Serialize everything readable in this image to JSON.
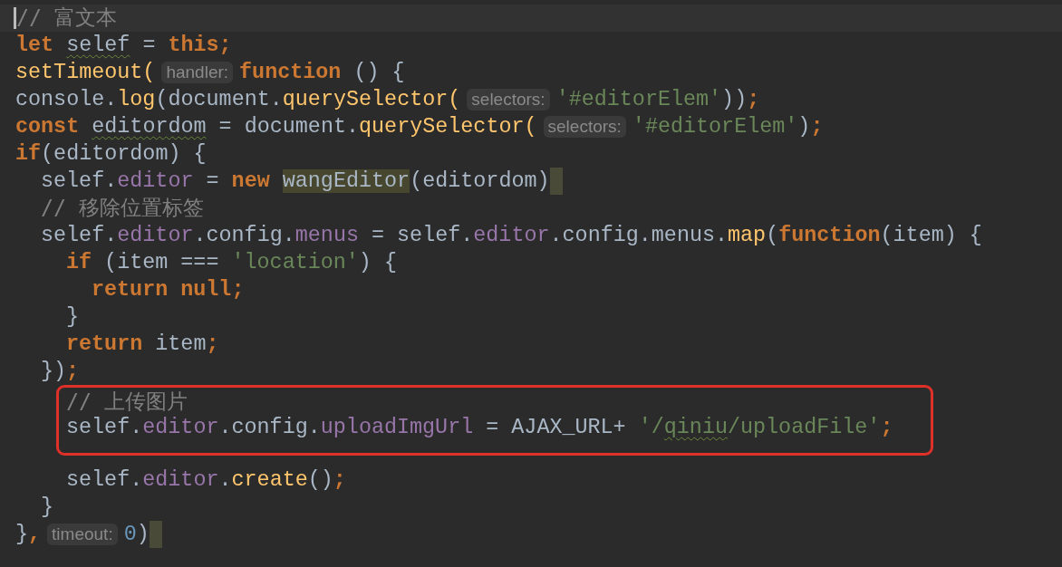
{
  "editor": {
    "lines": [
      {
        "current": true,
        "cursor": true,
        "tokens": [
          {
            "kind": "comment",
            "text": "// 富文本"
          }
        ]
      },
      {
        "tokens": [
          {
            "kind": "keyword",
            "text": "let "
          },
          {
            "kind": "text",
            "text": "selef",
            "warning": true
          },
          {
            "kind": "text",
            "text": " = "
          },
          {
            "kind": "keyword",
            "text": "this;"
          }
        ]
      },
      {
        "tokens": [
          {
            "kind": "call",
            "text": "setTimeout("
          },
          {
            "kind": "hint",
            "text": "handler:"
          },
          {
            "kind": "keyword",
            "text": "function"
          },
          {
            "kind": "text",
            "text": " () {"
          }
        ]
      },
      {
        "tokens": [
          {
            "kind": "text",
            "text": "console."
          },
          {
            "kind": "call",
            "text": "log"
          },
          {
            "kind": "text",
            "text": "(document."
          },
          {
            "kind": "call",
            "text": "querySelector("
          },
          {
            "kind": "hint",
            "text": "selectors:"
          },
          {
            "kind": "string",
            "text": "'#editorElem'"
          },
          {
            "kind": "text",
            "text": "))"
          },
          {
            "kind": "keyword",
            "text": ";"
          }
        ]
      },
      {
        "tokens": [
          {
            "kind": "keyword",
            "text": "const "
          },
          {
            "kind": "text",
            "text": "editordom",
            "warning": true
          },
          {
            "kind": "text",
            "text": " = document."
          },
          {
            "kind": "call",
            "text": "querySelector("
          },
          {
            "kind": "hint",
            "text": "selectors:"
          },
          {
            "kind": "string",
            "text": "'#editorElem'"
          },
          {
            "kind": "text",
            "text": ")"
          },
          {
            "kind": "keyword",
            "text": ";"
          }
        ]
      },
      {
        "tokens": [
          {
            "kind": "keyword",
            "text": "if"
          },
          {
            "kind": "text",
            "text": "(editordom) {"
          }
        ],
        "children": [
          {
            "bracket_marker": true,
            "tokens": [
              {
                "kind": "text",
                "text": "selef."
              },
              {
                "kind": "field",
                "text": "editor"
              },
              {
                "kind": "text",
                "text": " = "
              },
              {
                "kind": "keyword",
                "text": "new "
              },
              {
                "kind": "text",
                "text": "wangEditor",
                "highlighted": true
              },
              {
                "kind": "text",
                "text": "(editordom)"
              }
            ]
          },
          {
            "tokens": [
              {
                "kind": "comment",
                "text": "// 移除位置标签"
              }
            ]
          },
          {
            "tokens": [
              {
                "kind": "text",
                "text": "selef."
              },
              {
                "kind": "field",
                "text": "editor"
              },
              {
                "kind": "text",
                "text": ".config."
              },
              {
                "kind": "field",
                "text": "menus"
              },
              {
                "kind": "text",
                "text": " = selef."
              },
              {
                "kind": "field",
                "text": "editor"
              },
              {
                "kind": "text",
                "text": ".config.menus."
              },
              {
                "kind": "call",
                "text": "map"
              },
              {
                "kind": "text",
                "text": "("
              },
              {
                "kind": "keyword",
                "text": "function"
              },
              {
                "kind": "text",
                "text": "(item) {"
              }
            ],
            "children": [
              {
                "tokens": [
                  {
                    "kind": "keyword",
                    "text": "if"
                  },
                  {
                    "kind": "text",
                    "text": " (item === "
                  },
                  {
                    "kind": "string",
                    "text": "'location'"
                  },
                  {
                    "kind": "text",
                    "text": ") {"
                  }
                ],
                "children": [
                  {
                    "tokens": [
                      {
                        "kind": "keyword",
                        "text": "return null;"
                      }
                    ]
                  }
                ]
              },
              {
                "tokens": [
                  {
                    "kind": "text",
                    "text": "}"
                  }
                ]
              },
              {
                "tokens": [
                  {
                    "kind": "keyword",
                    "text": "return"
                  },
                  {
                    "kind": "text",
                    "text": " item"
                  },
                  {
                    "kind": "keyword",
                    "text": ";"
                  }
                ]
              }
            ]
          },
          {
            "tokens": [
              {
                "kind": "text",
                "text": "})"
              },
              {
                "kind": "keyword",
                "text": ";"
              }
            ],
            "children": [
              {
                "boxed": true,
                "tokens": [
                  {
                    "kind": "comment",
                    "text": "// 上传图片"
                  }
                ]
              },
              {
                "boxed": true,
                "tokens": [
                  {
                    "kind": "text",
                    "text": "selef."
                  },
                  {
                    "kind": "field",
                    "text": "editor"
                  },
                  {
                    "kind": "text",
                    "text": ".config."
                  },
                  {
                    "kind": "field",
                    "text": "uploadImgUrl"
                  },
                  {
                    "kind": "text",
                    "text": " = AJAX_URL+ "
                  },
                  {
                    "kind": "string",
                    "text": "'/"
                  },
                  {
                    "kind": "string",
                    "text": "qiniu",
                    "warning": true
                  },
                  {
                    "kind": "string",
                    "text": "/uploadFile'"
                  },
                  {
                    "kind": "keyword",
                    "text": ";"
                  }
                ]
              },
              {
                "boxed": true
              },
              {
                "tokens": [
                  {
                    "kind": "text",
                    "text": "selef."
                  },
                  {
                    "kind": "field",
                    "text": "editor"
                  },
                  {
                    "kind": "text",
                    "text": "."
                  },
                  {
                    "kind": "call",
                    "text": "create"
                  },
                  {
                    "kind": "text",
                    "text": "()"
                  },
                  {
                    "kind": "keyword",
                    "text": ";"
                  }
                ]
              }
            ]
          },
          {
            "tokens": [
              {
                "kind": "text",
                "text": "}"
              }
            ]
          }
        ]
      },
      {
        "bracket_marker": true,
        "tokens": [
          {
            "kind": "text",
            "text": "}"
          },
          {
            "kind": "keyword",
            "text": ","
          },
          {
            "kind": "hint",
            "text": "timeout:"
          },
          {
            "kind": "number",
            "text": "0"
          },
          {
            "kind": "text",
            "text": ")"
          }
        ]
      }
    ]
  }
}
